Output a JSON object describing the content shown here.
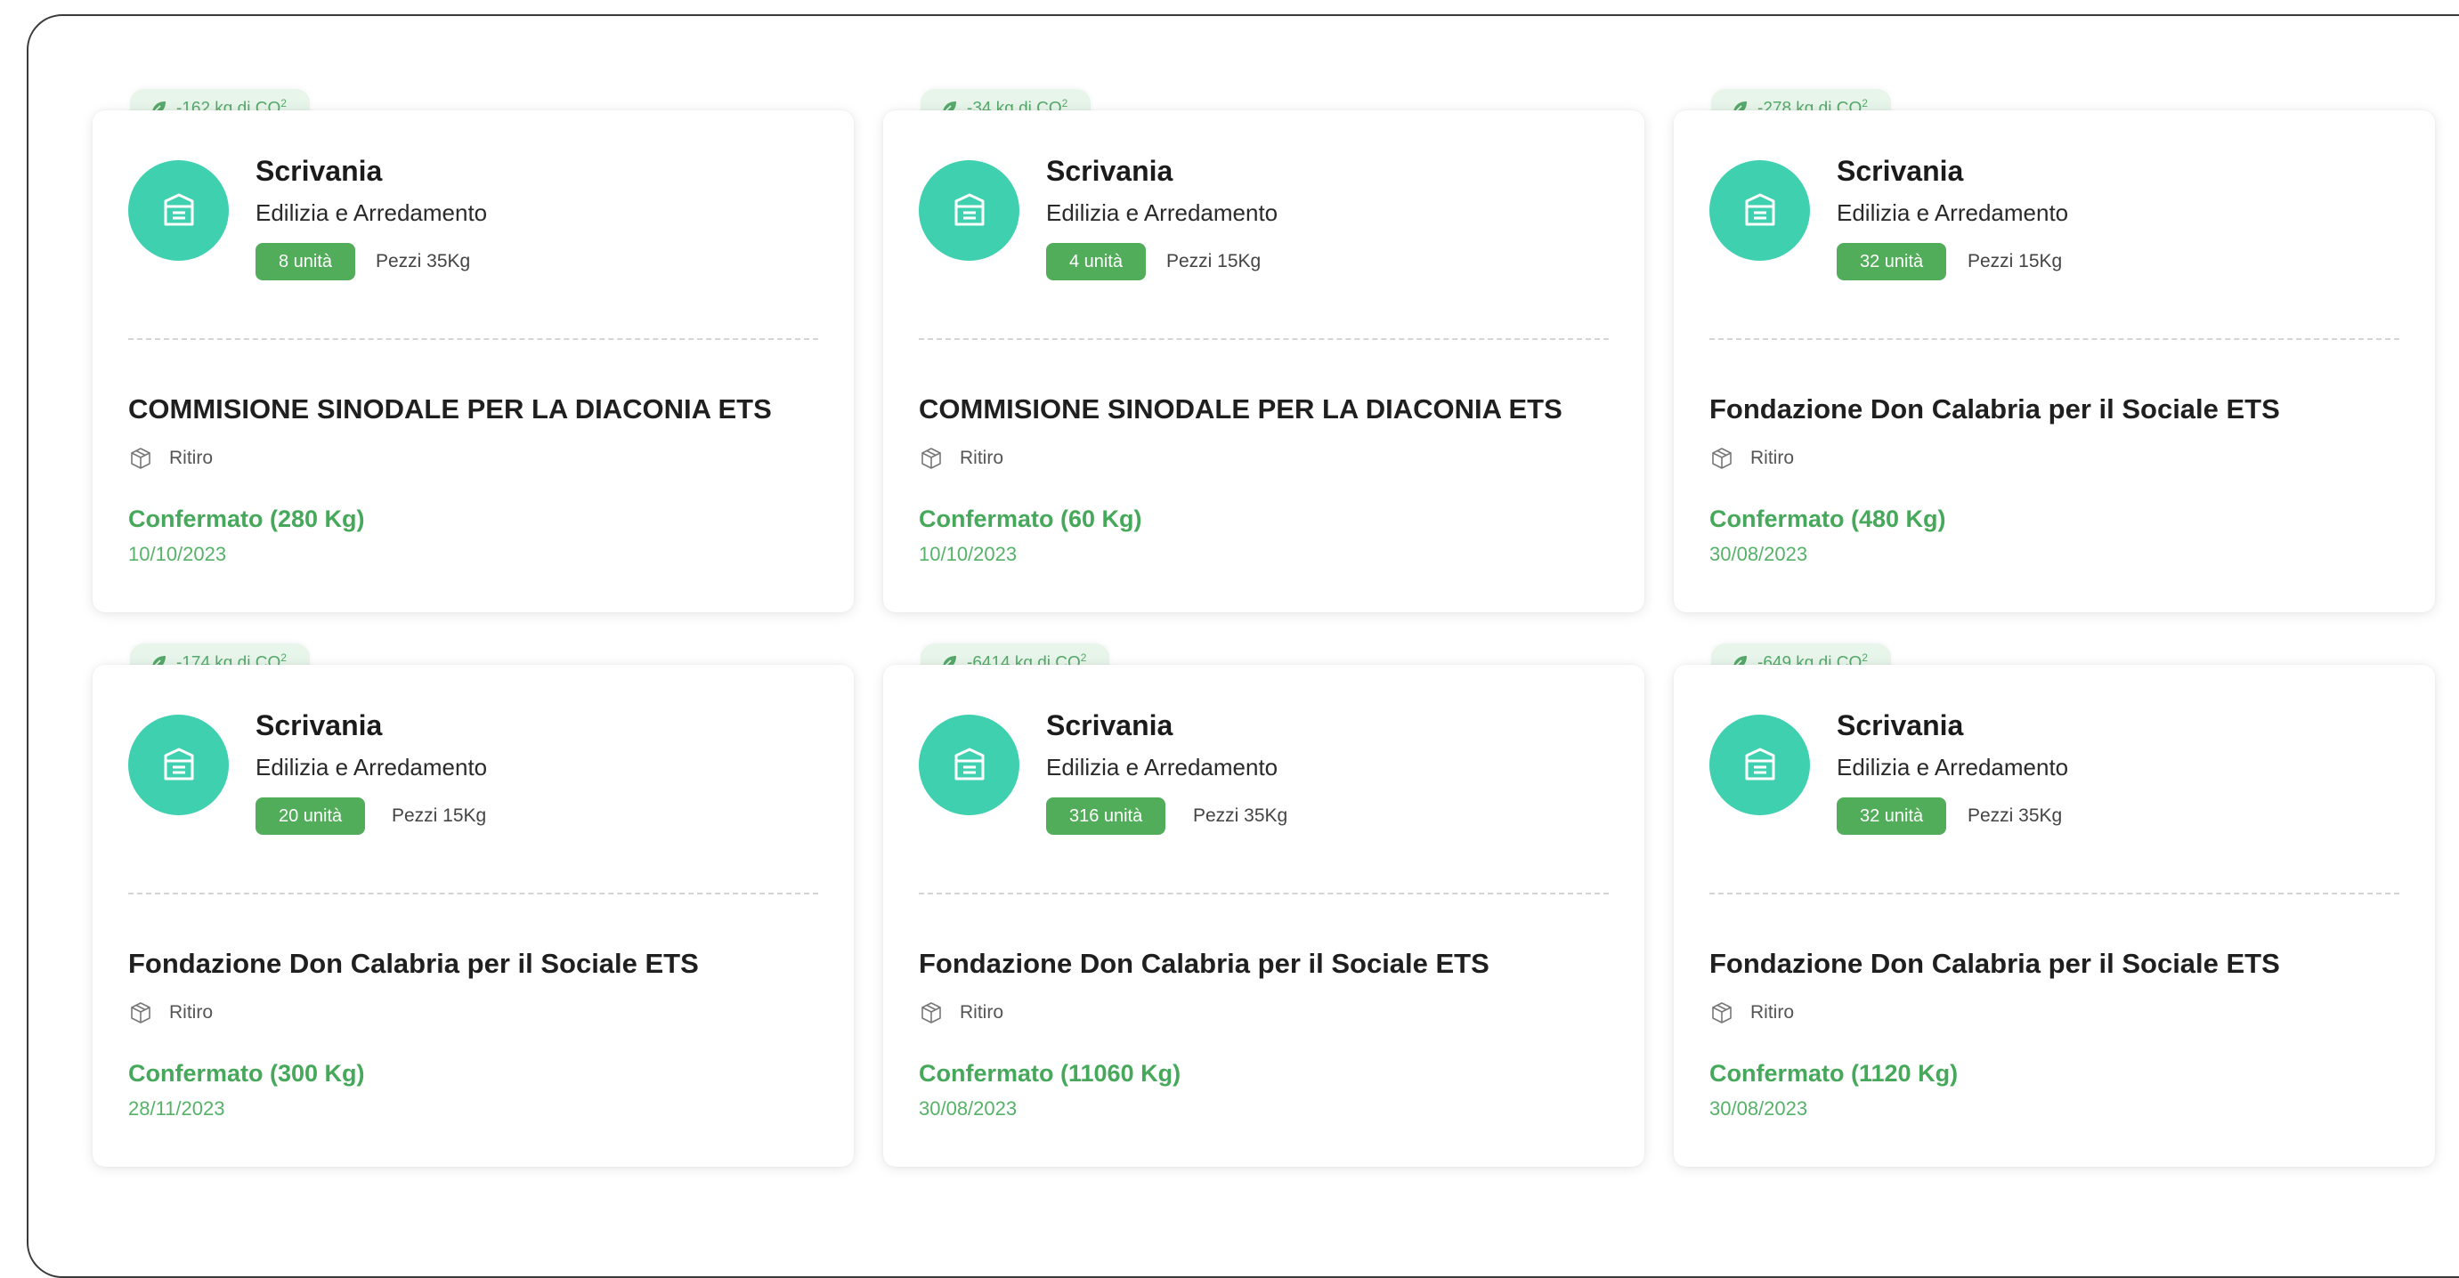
{
  "cards": [
    {
      "co2": "-162 kg di CO",
      "co2_sup": "2",
      "item_name": "Scrivania",
      "category": "Edilizia e Arredamento",
      "quantity": "8 unità",
      "pieces": "Pezzi 35Kg",
      "organization": "COMMISIONE SINODALE PER LA DIACONIA ETS",
      "pickup": "Ritiro",
      "status": "Confermato (280 Kg)",
      "date": "10/10/2023"
    },
    {
      "co2": "-34 kg di CO",
      "co2_sup": "2",
      "item_name": "Scrivania",
      "category": "Edilizia e Arredamento",
      "quantity": "4 unità",
      "pieces": "Pezzi 15Kg",
      "organization": "COMMISIONE SINODALE PER LA DIACONIA ETS",
      "pickup": "Ritiro",
      "status": "Confermato (60 Kg)",
      "date": "10/10/2023"
    },
    {
      "co2": "-278 kg di CO",
      "co2_sup": "2",
      "item_name": "Scrivania",
      "category": "Edilizia e Arredamento",
      "quantity": "32 unità",
      "pieces": "Pezzi 15Kg",
      "organization": "Fondazione Don Calabria per il Sociale ETS",
      "pickup": "Ritiro",
      "status": "Confermato (480 Kg)",
      "date": "30/08/2023"
    },
    {
      "co2": "-174 kg di CO",
      "co2_sup": "2",
      "item_name": "Scrivania",
      "category": "Edilizia e Arredamento",
      "quantity": "20 unità",
      "pieces": "Pezzi 15Kg",
      "organization": "Fondazione Don Calabria per il Sociale ETS",
      "pickup": "Ritiro",
      "status": "Confermato (300 Kg)",
      "date": "28/11/2023"
    },
    {
      "co2": "-6414 kg di CO",
      "co2_sup": "2",
      "item_name": "Scrivania",
      "category": "Edilizia e Arredamento",
      "quantity": "316 unità",
      "pieces": "Pezzi 35Kg",
      "organization": "Fondazione Don Calabria per il Sociale ETS",
      "pickup": "Ritiro",
      "status": "Confermato (11060 Kg)",
      "date": "30/08/2023"
    },
    {
      "co2": "-649 kg di CO",
      "co2_sup": "2",
      "item_name": "Scrivania",
      "category": "Edilizia e Arredamento",
      "quantity": "32 unità",
      "pieces": "Pezzi 35Kg",
      "organization": "Fondazione Don Calabria per il Sociale ETS",
      "pickup": "Ritiro",
      "status": "Confermato (1120 Kg)",
      "date": "30/08/2023"
    }
  ],
  "colors": {
    "accent_green": "#52ad5a",
    "avatar_teal": "#3fd0b0",
    "status_green": "#46a85a",
    "co2_tab_bg": "#e7f5ea"
  },
  "icons": {
    "co2": "leaf-icon",
    "avatar": "furniture-box-icon",
    "pickup": "package-icon"
  }
}
